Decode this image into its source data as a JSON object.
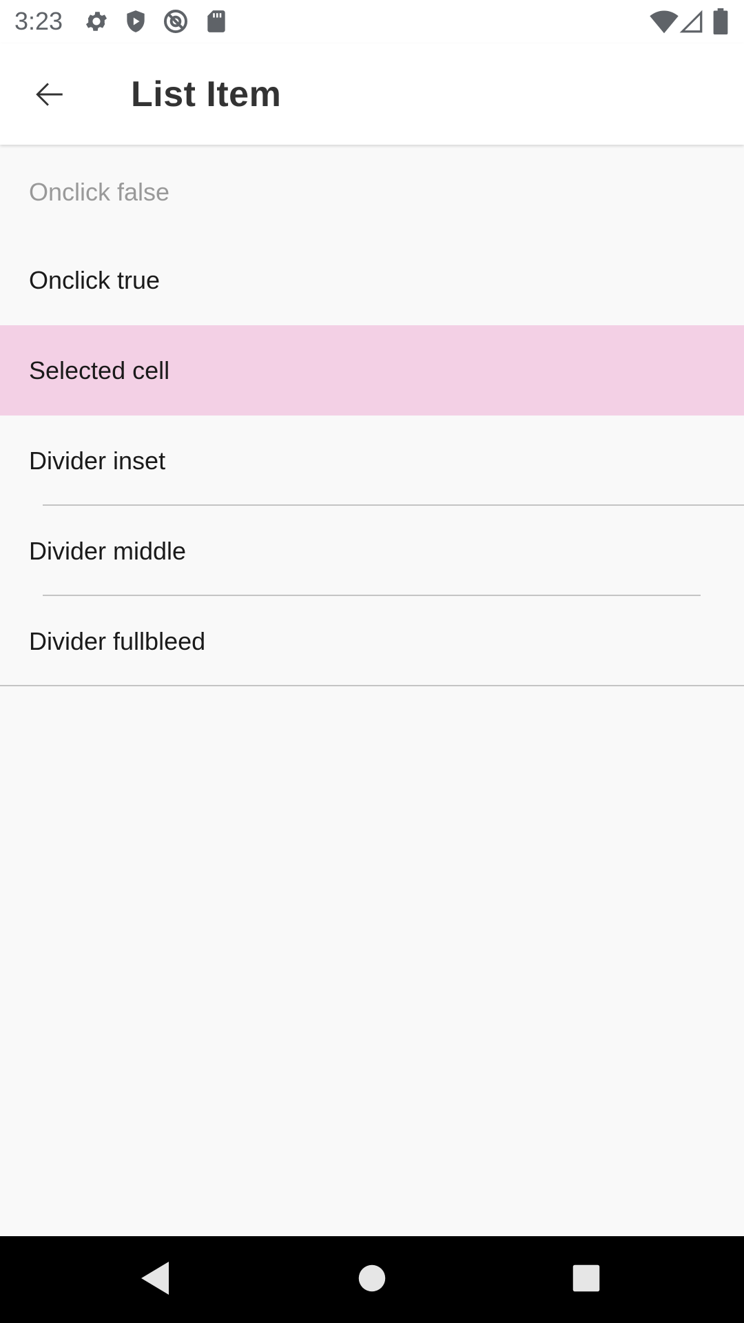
{
  "status_bar": {
    "time": "3:23",
    "left_icons": [
      "gear-icon",
      "shield-icon",
      "at-sign-icon",
      "sd-card-icon"
    ],
    "right_icons": [
      "wifi-icon",
      "signal-icon",
      "battery-icon"
    ]
  },
  "app_bar": {
    "title": "List Item",
    "back_icon": "arrow-left-icon"
  },
  "list": {
    "items": [
      {
        "label": "Onclick false",
        "state": "disabled",
        "divider": "none"
      },
      {
        "label": "Onclick true",
        "state": "enabled",
        "divider": "none"
      },
      {
        "label": "Selected cell",
        "state": "selected",
        "divider": "none"
      },
      {
        "label": "Divider inset",
        "state": "enabled",
        "divider": "inset"
      },
      {
        "label": "Divider middle",
        "state": "enabled",
        "divider": "middle"
      },
      {
        "label": "Divider fullbleed",
        "state": "enabled",
        "divider": "fullbleed"
      }
    ]
  },
  "nav_bar": {
    "icons": [
      "back-triangle-icon",
      "home-circle-icon",
      "recents-square-icon"
    ]
  },
  "colors": {
    "selected_background": "#f3d0e5",
    "background": "#f9f9f9",
    "divider": "#c4c4c4",
    "disabled_text": "#999999"
  }
}
